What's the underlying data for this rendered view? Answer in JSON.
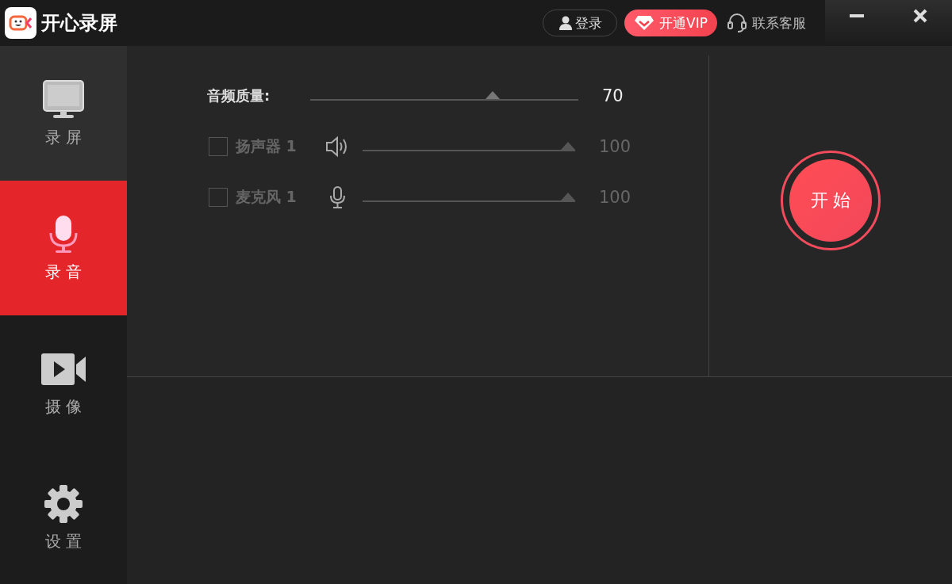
{
  "window": {
    "title": "开心录屏"
  },
  "header": {
    "login": "登录",
    "vip": "开通VIP",
    "support": "联系客服",
    "controls": [
      {
        "kind": "minimize"
      },
      {
        "kind": "close"
      }
    ]
  },
  "sidebar": {
    "items": [
      {
        "kind": "screen",
        "label": "录 屏",
        "selected": false,
        "hovered": true
      },
      {
        "kind": "mic",
        "label": "录 音",
        "selected": true,
        "hovered": false
      },
      {
        "kind": "camera",
        "label": "摄 像",
        "selected": false,
        "hovered": false
      },
      {
        "kind": "settings",
        "label": "设 置",
        "selected": false,
        "hovered": false
      }
    ]
  },
  "quality": {
    "label": "音频质量:",
    "level": 0.69,
    "reading": "70"
  },
  "devices": [
    {
      "kind": "speaker",
      "label": "扬声器 1",
      "checked": false,
      "disabled": true,
      "level": 1,
      "reading": "100"
    },
    {
      "kind": "mic",
      "label": "麦克风 1",
      "checked": false,
      "disabled": true,
      "level": 1,
      "reading": "100"
    }
  ],
  "start_button": {
    "label": "开 始"
  }
}
